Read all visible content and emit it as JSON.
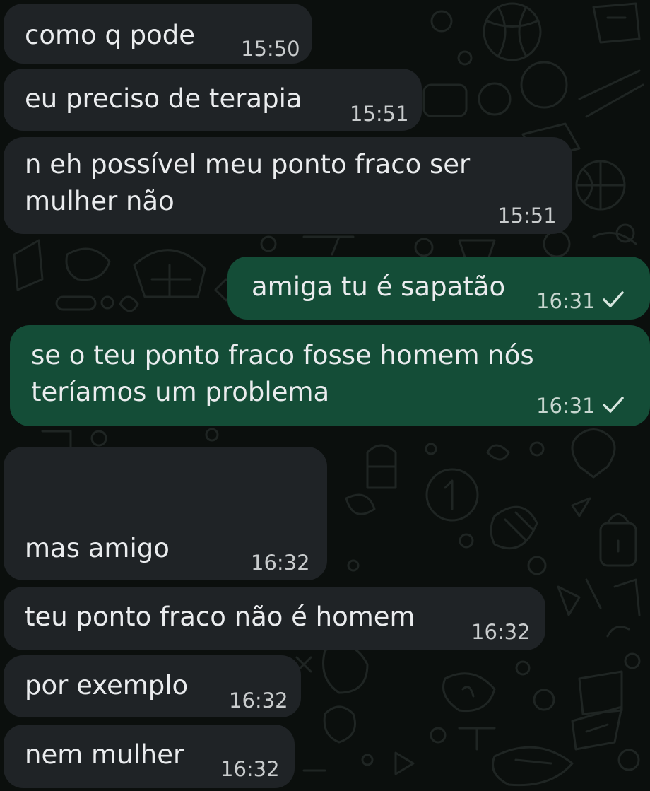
{
  "colors": {
    "background": "#0b0f0d",
    "incoming_bubble": "#1f2326",
    "outgoing_bubble": "#144d37",
    "text": "#eaecee",
    "timestamp": "#c9cccd",
    "tick": "#d7e6df"
  },
  "messages": [
    {
      "direction": "incoming",
      "lines": [
        "como q pode"
      ],
      "time": "15:50"
    },
    {
      "direction": "incoming",
      "lines": [
        "eu preciso de terapia"
      ],
      "time": "15:51"
    },
    {
      "direction": "incoming",
      "lines": [
        "n eh possível meu ponto fraco ser",
        "mulher não"
      ],
      "time": "15:51"
    },
    {
      "direction": "outgoing",
      "lines": [
        "amiga tu é sapatão"
      ],
      "time": "16:31",
      "status_icon": "single-check-icon"
    },
    {
      "direction": "outgoing",
      "lines": [
        "se o teu ponto fraco fosse homem nós",
        "teríamos um problema"
      ],
      "time": "16:31",
      "status_icon": "single-check-icon"
    },
    {
      "direction": "incoming",
      "lines": [
        "",
        "",
        "mas amigo"
      ],
      "time": "16:32"
    },
    {
      "direction": "incoming",
      "lines": [
        "teu ponto fraco não é homem"
      ],
      "time": "16:32"
    },
    {
      "direction": "incoming",
      "lines": [
        "por exemplo"
      ],
      "time": "16:32"
    },
    {
      "direction": "incoming",
      "lines": [
        "nem mulher"
      ],
      "time": "16:32"
    }
  ]
}
